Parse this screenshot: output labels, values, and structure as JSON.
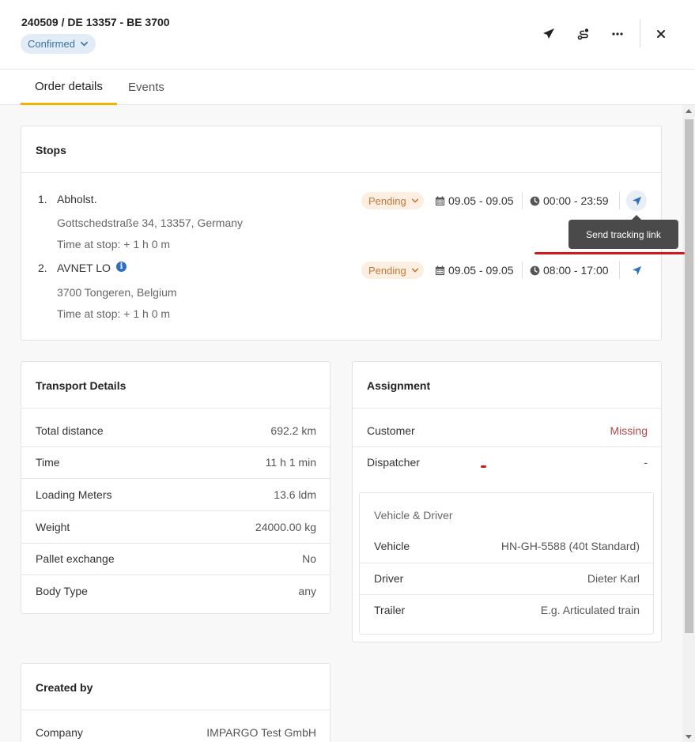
{
  "header": {
    "order_id": "240509 / DE 13357 - BE 3700",
    "status": "Confirmed"
  },
  "tabs": [
    {
      "label": "Order details",
      "active": true
    },
    {
      "label": "Events",
      "active": false
    }
  ],
  "stops": {
    "title": "Stops",
    "items": [
      {
        "num": "1.",
        "name": "Abholst.",
        "address": "Gottschedstraße 34, 13357, Germany",
        "time_at_stop": "Time at stop: + 1 h 0 m",
        "status": "Pending",
        "date": "09.05 - 09.05",
        "time": "00:00 - 23:59",
        "has_info": false
      },
      {
        "num": "2.",
        "name": "AVNET LO",
        "address": "3700 Tongeren, Belgium",
        "time_at_stop": "Time at stop: + 1 h 0 m",
        "status": "Pending",
        "date": "09.05 - 09.05",
        "time": "08:00 - 17:00",
        "has_info": true
      }
    ],
    "tooltip": "Send tracking link"
  },
  "transport": {
    "title": "Transport Details",
    "rows": [
      {
        "label": "Total distance",
        "value": "692.2 km"
      },
      {
        "label": "Time",
        "value": "11 h 1 min"
      },
      {
        "label": "Loading Meters",
        "value": "13.6 ldm"
      },
      {
        "label": "Weight",
        "value": "24000.00 kg"
      },
      {
        "label": "Pallet exchange",
        "value": "No"
      },
      {
        "label": "Body Type",
        "value": "any"
      }
    ]
  },
  "assignment": {
    "title": "Assignment",
    "rows": [
      {
        "label": "Customer",
        "value": "Missing"
      },
      {
        "label": "Dispatcher",
        "value": "-"
      }
    ],
    "vehicle_driver": {
      "title": "Vehicle & Driver",
      "rows": [
        {
          "label": "Vehicle",
          "value": "HN-GH-5588 (40t Standard)"
        },
        {
          "label": "Driver",
          "value": "Dieter Karl"
        },
        {
          "label": "Trailer",
          "value": "E.g. Articulated train"
        }
      ]
    }
  },
  "created_by": {
    "title": "Created by",
    "rows": [
      {
        "label": "Company",
        "value": "IMPARGO Test GmbH"
      }
    ]
  },
  "colors": {
    "accent_tab": "#f0b400",
    "status_confirmed_bg": "#e2ecf6",
    "status_pending_bg": "#fcefe1",
    "missing": "#b34a4a",
    "annotation_red": "#d01818"
  },
  "icons": [
    "paper-plane-icon",
    "route-icon",
    "more-icon",
    "close-icon",
    "calendar-icon",
    "clock-icon",
    "navigation-arrow-icon",
    "chevron-down-icon",
    "info-icon"
  ]
}
